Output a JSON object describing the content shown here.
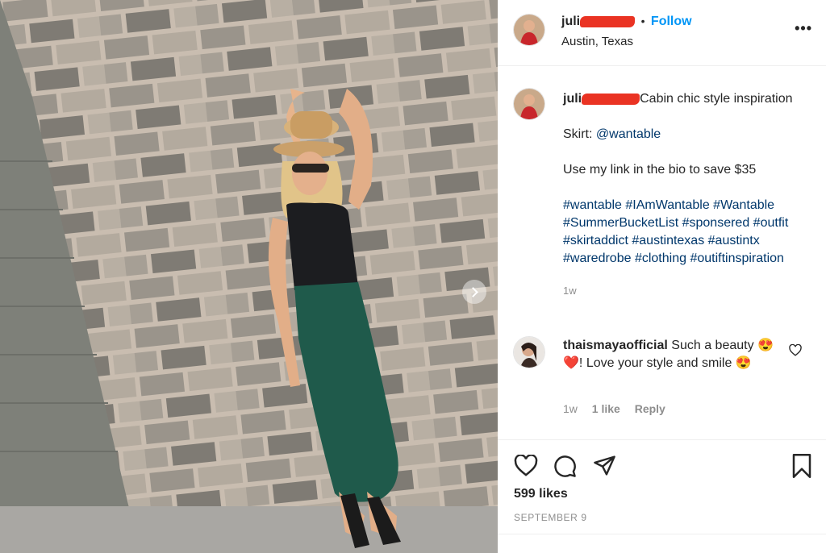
{
  "post_header": {
    "username": "juli",
    "follow_label": "Follow",
    "dot": "•",
    "location": "Austin, Texas",
    "more_icon": "more-horizontal-icon"
  },
  "caption": {
    "username": "juli",
    "title": "Cabin chic style inspiration",
    "skirt_label": "Skirt:",
    "skirt_mention": "@wantable",
    "promo": "Use my link in the bio to save $35",
    "hashtags": "#wantable #IAmWantable #Wantable #SummerBucketList #sponsered #outfit #skirtaddict #austintexas #austintx #waredrobe #clothing #outiftinspiration",
    "time": "1w"
  },
  "comment": {
    "username": "thaismayaofficial",
    "text_part1": "Such a beauty",
    "emoji_line": "😍❤️",
    "text_part2": "! Love your style and smile",
    "emoji_end": "😍",
    "time": "1w",
    "likes": "1 like",
    "reply": "Reply"
  },
  "actions": {
    "likes": "599 likes",
    "date": "SEPTEMBER 9"
  },
  "colors": {
    "link_blue": "#0095f6",
    "hashtag_blue": "#00376b",
    "redaction": "#ea3323",
    "skirt_green": "#1f5a4b"
  }
}
